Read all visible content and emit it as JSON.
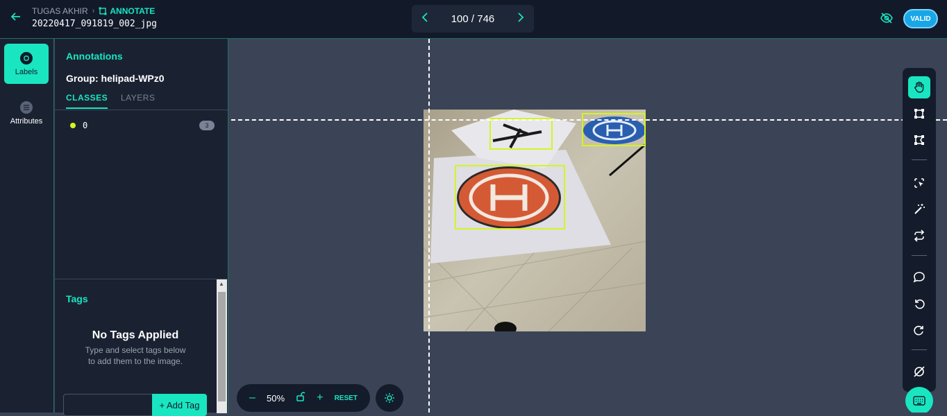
{
  "header": {
    "breadcrumb_project": "TUGAS AKHIR",
    "breadcrumb_section": "ANNOTATE",
    "filename": "20220417_091819_002_jpg",
    "pager": "100 / 746",
    "valid_label": "VALID"
  },
  "leftrail": {
    "labels": "Labels",
    "attributes": "Attributes"
  },
  "panel": {
    "title": "Annotations",
    "group": "Group: helipad-WPz0",
    "tab_classes": "CLASSES",
    "tab_layers": "LAYERS",
    "classes": [
      {
        "name": "0",
        "count": "3",
        "color": "#d4f51f"
      }
    ]
  },
  "tags": {
    "title": "Tags",
    "empty_title": "No Tags Applied",
    "empty_line1": "Type and select tags below",
    "empty_line2": "to add them to the image.",
    "add_button": "+ Add Tag"
  },
  "zoom": {
    "minus": "–",
    "value": "50%",
    "plus": "+",
    "reset": "RESET"
  },
  "colors": {
    "accent": "#19e6c1",
    "bbox": "#d4f51f",
    "valid": "#18a6e6"
  }
}
